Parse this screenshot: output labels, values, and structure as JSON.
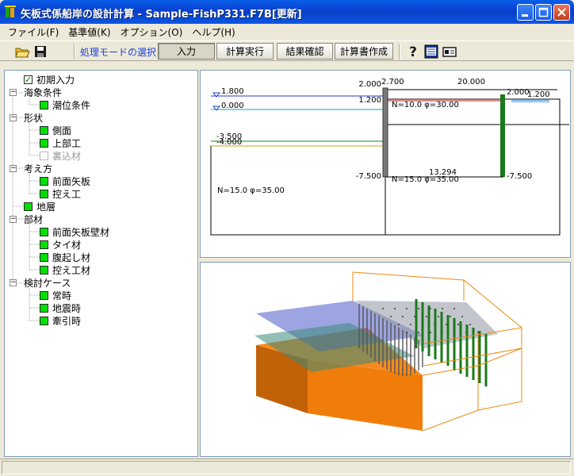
{
  "window": {
    "title": "矢板式係船岸の設計計算 - Sample-FishP331.F7B[更新]"
  },
  "menu": [
    {
      "label": "ファイル(F)"
    },
    {
      "label": "基準値(K)"
    },
    {
      "label": "オプション(O)"
    },
    {
      "label": "ヘルプ(H)"
    }
  ],
  "toolbar": {
    "mode_label": "処理モードの選択",
    "buttons": [
      {
        "label": "入力",
        "active": true
      },
      {
        "label": "計算実行"
      },
      {
        "label": "結果確認"
      },
      {
        "label": "計算書作成"
      }
    ]
  },
  "tree": [
    {
      "label": "初期入力"
    },
    {
      "label": "海象条件"
    },
    {
      "label": "潮位条件"
    },
    {
      "label": "形状"
    },
    {
      "label": "側面"
    },
    {
      "label": "上部工"
    },
    {
      "label": "裏込材"
    },
    {
      "label": "考え方"
    },
    {
      "label": "前面矢板"
    },
    {
      "label": "控え工"
    },
    {
      "label": "地層"
    },
    {
      "label": "部材"
    },
    {
      "label": "前面矢板壁材"
    },
    {
      "label": "タイ材"
    },
    {
      "label": "腹起し材"
    },
    {
      "label": "控え工材"
    },
    {
      "label": "検討ケース"
    },
    {
      "label": "常時"
    },
    {
      "label": "地震時"
    },
    {
      "label": "牽引時"
    }
  ],
  "drawing2d": {
    "levels": {
      "hwl": "1.800",
      "lwl": "0.000",
      "sea_bed": "-3.500",
      "sea_bed2": "-4.000",
      "wall_top": "2.000",
      "tie": "1.200",
      "wall_tip": "-7.500",
      "anchor_top": "2.000",
      "anchor_tie": "1.200",
      "anchor_tip": "-7.500"
    },
    "dims": {
      "crown": "2.700",
      "tie_length": "20.000",
      "depth": "13.294"
    },
    "soils": {
      "upper_right": "N=10.0 φ=30.00",
      "lower_right": "N=15.0 φ=35.00",
      "lower_left": "N=15.0 φ=35.00"
    }
  },
  "colors": {
    "sheet_pile": "#1a7a1a",
    "soil": "#e87800",
    "water": "#4a5ac8",
    "title_bar": "#0a5ee8",
    "tree_box": "#00e000"
  }
}
